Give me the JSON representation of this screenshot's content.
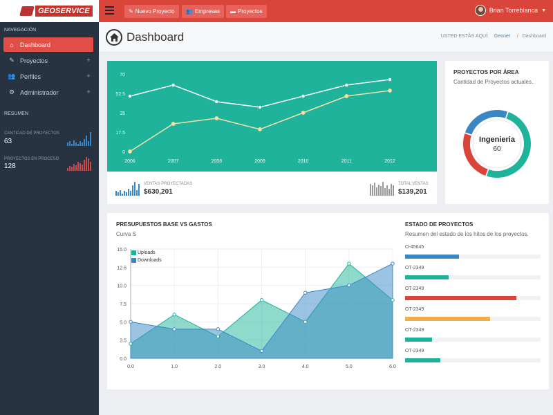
{
  "topbar": {
    "logo_text": "GEOSERVICE",
    "buttons": [
      {
        "label": "Nuevo Proyecto",
        "icon": "edit-icon"
      },
      {
        "label": "Empresas",
        "icon": "users-icon"
      },
      {
        "label": "Proyectos",
        "icon": "folder-icon"
      }
    ],
    "user_name": "Brian Torreblanca"
  },
  "sidebar": {
    "nav_heading": "NAVEGACIÓN",
    "items": [
      {
        "label": "Dashboard",
        "icon": "home-icon",
        "active": true
      },
      {
        "label": "Proyectos",
        "icon": "edit-icon",
        "expandable": true
      },
      {
        "label": "Perfiles",
        "icon": "users-icon",
        "expandable": true
      },
      {
        "label": "Administrador",
        "icon": "gear-icon",
        "expandable": true
      }
    ],
    "summary_heading": "RESUMEN",
    "stats": [
      {
        "label": "CANTIDAD DE PROYECTOS",
        "value": "63",
        "color": "#3a87c5",
        "bars": [
          3,
          4,
          2,
          5,
          3,
          2,
          4,
          3,
          6,
          9,
          4,
          12
        ]
      },
      {
        "label": "PROYECTOS EN PROCESO",
        "value": "128",
        "color": "#c94a4a",
        "bars": [
          4,
          6,
          5,
          9,
          7,
          12,
          10,
          8,
          14,
          18,
          16,
          12
        ]
      }
    ]
  },
  "header": {
    "title": "Dashboard",
    "breadcrumb_prefix": "USTED ESTÁS AQUÍ",
    "breadcrumb_link": "Geonet",
    "breadcrumb_sep": "/",
    "breadcrumb_current": "Dashboard"
  },
  "sales": {
    "projected_label": "VENTAS PROYECTADAS",
    "projected_value": "$630,201",
    "total_label": "TOTAL VENTAS",
    "total_value": "$139,201"
  },
  "areas": {
    "title": "PROYECTOS POR ÁREA",
    "subtitle": "Cantidad de Proyectos actuales..",
    "center_label": "Ingenieria",
    "center_value": "60"
  },
  "budget": {
    "title": "PRESUPUESTOS BASE VS GASTOS",
    "subtitle": "Curva S"
  },
  "status": {
    "title": "ESTADO DE PROYECTOS",
    "subtitle": "Resumen del estado de los hitos de los proyectos.",
    "items": [
      {
        "label": "O-45645",
        "value": 0.4,
        "color": "#3a87c5"
      },
      {
        "label": "OT-2349",
        "value": 0.32,
        "color": "#1fb39c"
      },
      {
        "label": "OT-2349",
        "value": 0.82,
        "color": "#d9443b"
      },
      {
        "label": "OT-2349",
        "value": 0.63,
        "color": "#f0ad4e"
      },
      {
        "label": "OT-2349",
        "value": 0.2,
        "color": "#1fb39c"
      },
      {
        "label": "OT-2349",
        "value": 0.26,
        "color": "#1fb39c"
      }
    ]
  },
  "chart_data": [
    {
      "type": "line",
      "x": [
        "2006",
        "2007",
        "2008",
        "2009",
        "2010",
        "2011",
        "2012"
      ],
      "yticks": [
        "0",
        "17.5",
        "35",
        "52.5",
        "70"
      ],
      "ylim": [
        0,
        70
      ],
      "series": [
        {
          "values": [
            50,
            60,
            45,
            40,
            50,
            60,
            65
          ],
          "color": "#ffffff"
        },
        {
          "values": [
            0,
            25,
            30,
            20,
            35,
            50,
            55
          ],
          "color": "#f3e3a8"
        }
      ],
      "grid": false
    },
    {
      "type": "donut",
      "slices": [
        {
          "value": 50,
          "color": "#1fb39c"
        },
        {
          "value": 25,
          "color": "#d9443b"
        },
        {
          "value": 25,
          "color": "#3a87c5"
        }
      ]
    },
    {
      "type": "area",
      "x": [
        0,
        1,
        2,
        3,
        4,
        5,
        6
      ],
      "xticks": [
        "0.0",
        "1.0",
        "2.0",
        "3.0",
        "4.0",
        "5.0",
        "6.0"
      ],
      "yticks": [
        "0.0",
        "2.5",
        "5.0",
        "7.5",
        "10.0",
        "12.5",
        "15.0"
      ],
      "ylim": [
        0,
        15
      ],
      "series": [
        {
          "name": "Uploads",
          "values": [
            2,
            6,
            3,
            8,
            5,
            13,
            8
          ],
          "color": "#1fb39c"
        },
        {
          "name": "Downloads",
          "values": [
            5,
            4,
            4,
            1,
            9,
            10,
            13
          ],
          "color": "#3a87c5"
        }
      ],
      "legend": "top-left",
      "grid": true
    }
  ]
}
